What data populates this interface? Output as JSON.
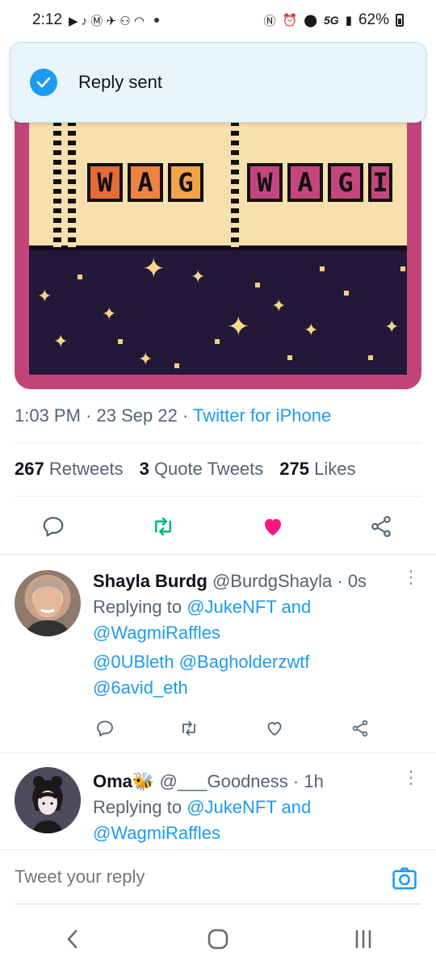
{
  "status_bar": {
    "time": "2:12",
    "network": "5G",
    "battery": "62%"
  },
  "toast": {
    "message": "Reply sent",
    "icon": "check-circle-icon"
  },
  "tweet": {
    "time": "1:03 PM",
    "separator": "·",
    "date": "23 Sep 22",
    "source": "Twitter for iPhone",
    "media_text": "WAGWAG",
    "stats": {
      "retweets_count": "267",
      "retweets_label": "Retweets",
      "quotes_count": "3",
      "quotes_label": "Quote Tweets",
      "likes_count": "275",
      "likes_label": "Likes"
    }
  },
  "replies": [
    {
      "name": "Shayla Burdg",
      "handle": "@BurdgShayla",
      "age": "· 0s",
      "replying_prefix": "Replying to",
      "to1": "@JukeNFT",
      "and": "and",
      "to2": "@WagmiRaffles",
      "mentions1": "@0UBleth @Bagholderzwtf",
      "mentions2": "@6avid_eth"
    },
    {
      "name": "Oma",
      "emoji": "🐝",
      "handle": "@___Goodness",
      "age": "· 1h",
      "replying_prefix": "Replying to",
      "to1": "@JukeNFT",
      "and": "and",
      "to2": "@WagmiRaffles"
    }
  ],
  "compose": {
    "placeholder": "Tweet your reply"
  },
  "colors": {
    "accent": "#1d9bf0",
    "retweet_green": "#00ba7c",
    "like_pink": "#f91880"
  }
}
